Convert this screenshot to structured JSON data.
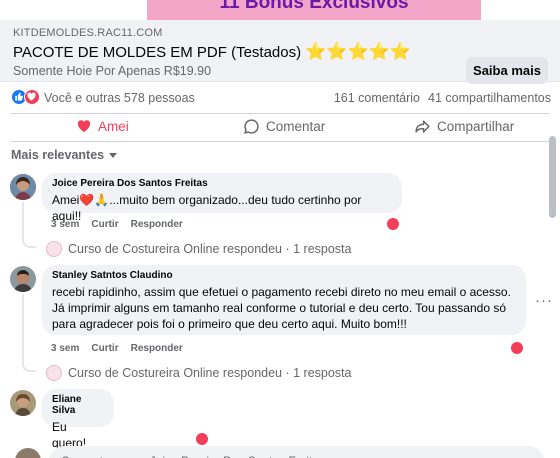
{
  "banner": {
    "text": "11 Bônus Exclusivos"
  },
  "ad": {
    "domain": "KITDEMOLDES.RAC11.COM",
    "title": "PACOTE DE MOLDES EM PDF (Testados)",
    "stars": "⭐⭐⭐⭐⭐",
    "subtitle": "Somente Hoie Por Apenas R$19.90",
    "cta_label": "Saiba mais"
  },
  "reactions": {
    "text": "Você e outras 578 pessoas",
    "comments_count": "161 comentário",
    "shares_count": "41 compartilhamentos"
  },
  "actions": {
    "react_label": "Amei",
    "comment_label": "Comentar",
    "share_label": "Compartilhar"
  },
  "sort": {
    "label": "Mais relevantes"
  },
  "comments": [
    {
      "name": "Joice Pereira Dos Santos Freitas",
      "text": "Amei❤️🙏...muito bem organizado...deu tudo certinho por aqui!!",
      "time": "3 sem",
      "like": "Curtir",
      "reply": "Responder",
      "page_reply": "Curso de Costureira Online respondeu · 1 resposta"
    },
    {
      "name": "Stanley Satntos Claudino",
      "text": "recebi rapidinho, assim que efetuei o pagamento recebi direto no meu email o acesso.\nJá imprimir alguns em tamanho real conforme o tutorial e deu certo. Tou passando só\npara agradecer pois foi o primeiro que deu certo aqui. Muito bom!!!",
      "time": "3 sem",
      "like": "Curtir",
      "reply": "Responder",
      "page_reply": "Curso de Costureira Online respondeu · 1 resposta",
      "more": "···"
    },
    {
      "name": "Eliane Silva",
      "text": "Eu quero!"
    }
  ],
  "composer": {
    "placeholder": "Comentar como Joice Pereira Dos Santos Freitas"
  },
  "colors": {
    "love": "#f33e58",
    "like": "#1877f2",
    "bubble": "#f0f2f5",
    "muted": "#65676b"
  }
}
